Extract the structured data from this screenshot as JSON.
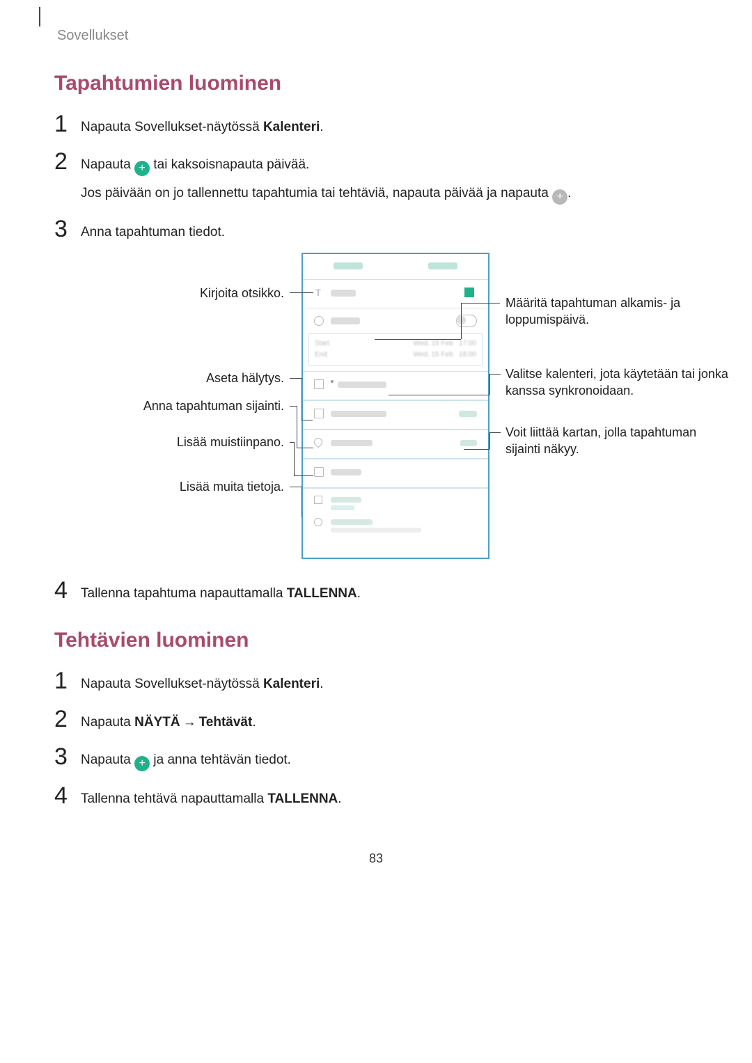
{
  "header": "Sovellukset",
  "page_number": "83",
  "section1": {
    "title": "Tapahtumien luominen",
    "steps": {
      "s1": {
        "num": "1",
        "text_a": "Napauta Sovellukset-näytössä ",
        "bold": "Kalenteri",
        "text_b": "."
      },
      "s2": {
        "num": "2",
        "text_a": "Napauta ",
        "text_b": " tai kaksoisnapauta päivää.",
        "sub_a": "Jos päivään on jo tallennettu tapahtumia tai tehtäviä, napauta päivää ja napauta ",
        "sub_b": "."
      },
      "s3": {
        "num": "3",
        "text": "Anna tapahtuman tiedot."
      },
      "s4": {
        "num": "4",
        "text_a": "Tallenna tapahtuma napauttamalla ",
        "bold": "TALLENNA",
        "text_b": "."
      }
    }
  },
  "diagram": {
    "left": {
      "l1": "Kirjoita otsikko.",
      "l2": "Aseta hälytys.",
      "l3": "Anna tapahtuman sijainti.",
      "l4": "Lisää muistiinpano.",
      "l5": "Lisää muita tietoja."
    },
    "right": {
      "r1": "Määritä tapahtuman alkamis- ja loppumispäivä.",
      "r2": "Valitse kalenteri, jota käytetään tai jonka kanssa synkronoidaan.",
      "r3": "Voit liittää kartan, jolla tapahtuman sijainti näkyy."
    }
  },
  "section2": {
    "title": "Tehtävien luominen",
    "steps": {
      "s1": {
        "num": "1",
        "text_a": "Napauta Sovellukset-näytössä ",
        "bold": "Kalenteri",
        "text_b": "."
      },
      "s2": {
        "num": "2",
        "text_a": "Napauta ",
        "bold1": "NÄYTÄ",
        "arrow": "→",
        "bold2": "Tehtävät",
        "text_b": "."
      },
      "s3": {
        "num": "3",
        "text_a": "Napauta ",
        "text_b": " ja anna tehtävän tiedot."
      },
      "s4": {
        "num": "4",
        "text_a": "Tallenna tehtävä napauttamalla ",
        "bold": "TALLENNA",
        "text_b": "."
      }
    }
  }
}
